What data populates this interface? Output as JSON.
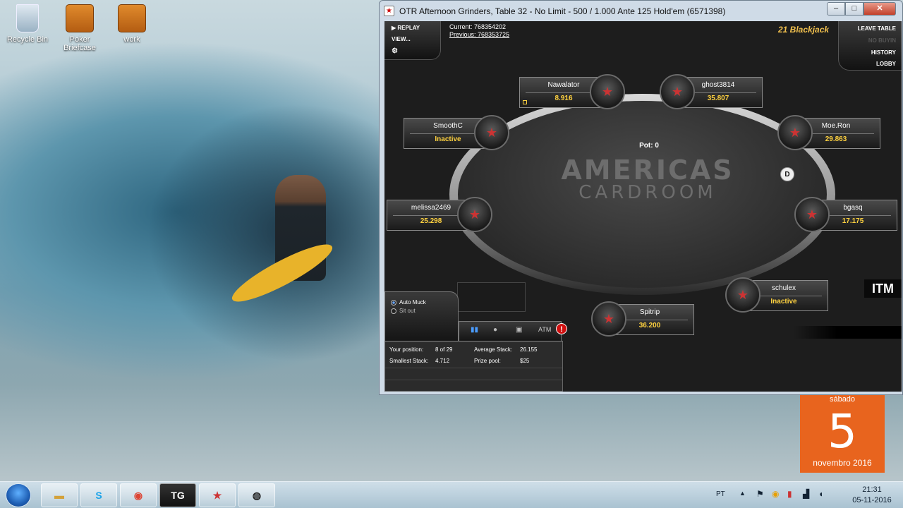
{
  "desktop": {
    "icons": [
      {
        "label": "Recycle Bin"
      },
      {
        "label": "Poker Briefcase"
      },
      {
        "label": "work"
      }
    ]
  },
  "window": {
    "title": "OTR Afternoon Grinders, Table 32 - No Limit - 500 / 1.000  Ante 125 Hold'em (6571398)",
    "app_icon": "star",
    "min": "–",
    "max": "□",
    "close": "✕"
  },
  "toolbar": {
    "replay": "▶ REPLAY",
    "view": "VIEW...",
    "settings": "⚙"
  },
  "hand": {
    "current": "Current: 768354202",
    "previous": "Previous: 768353725"
  },
  "right_menu": {
    "leave": "LEAVE TABLE",
    "no_buyin": "NO BUYIN",
    "history": "HISTORY",
    "lobby": "LOBBY",
    "brand": "21 Blackjack"
  },
  "table": {
    "pot": "Pot: 0",
    "dealer": "D",
    "logo_line1": "AMERICAS",
    "logo_line2": "CARDROOM"
  },
  "seats": [
    {
      "name": "Nawalator",
      "stack": "8.916"
    },
    {
      "name": "ghost3814",
      "stack": "35.807"
    },
    {
      "name": "SmoothC",
      "stack": "Inactive"
    },
    {
      "name": "Moe.Ron",
      "stack": "29.863"
    },
    {
      "name": "melissa2469",
      "stack": "25.298"
    },
    {
      "name": "bgasq",
      "stack": "17.175"
    },
    {
      "name": "schulex",
      "stack": "Inactive"
    },
    {
      "name": "Spitrip",
      "stack": "36.200"
    }
  ],
  "controls": {
    "auto_muck": "Auto Muck",
    "sit_out": "Sit out",
    "atm": "ATM",
    "alert": "!"
  },
  "stats": {
    "your_position_label": "Your position:",
    "your_position": "8 of 29",
    "average_stack_label": "Average Stack:",
    "average_stack": "26.155",
    "smallest_stack_label": "Smallest Stack:",
    "smallest_stack": "4.712",
    "prize_pool_label": "Prize pool:",
    "prize_pool": "$25"
  },
  "itm": "ITM",
  "calendar": {
    "weekday": "sábado",
    "day": "5",
    "month_year": "novembro 2016"
  },
  "taskbar": {
    "tg_label": "TG",
    "lang": "PT",
    "time": "21:31",
    "date": "05-11-2016"
  },
  "colors": {
    "stack_yellow": "#ffd23f",
    "calendar_orange": "#e8641e",
    "alert_red": "#d01010"
  }
}
